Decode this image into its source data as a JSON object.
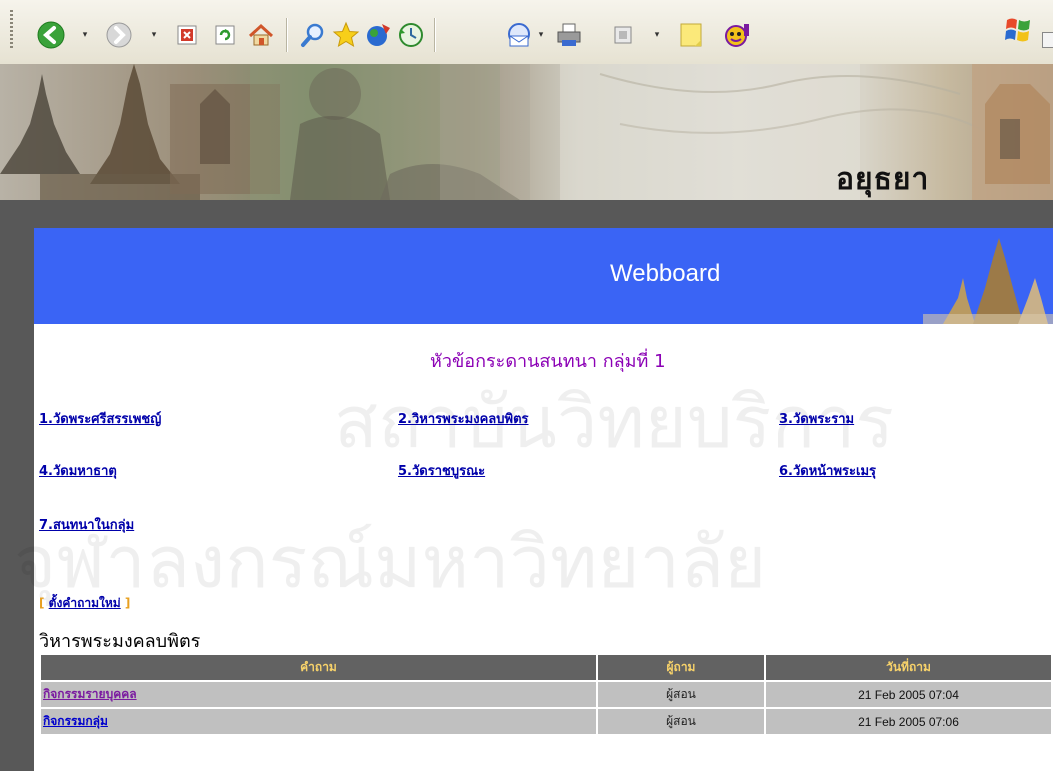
{
  "toolbar": {
    "buttons": [
      {
        "name": "back-button",
        "icon": "back-arrow-icon",
        "color": "#2e9a2e"
      },
      {
        "name": "forward-button",
        "icon": "forward-arrow-icon",
        "color": "#9a9a9a"
      },
      {
        "name": "stop-button",
        "icon": "stop-icon",
        "color": "#d23a2a"
      },
      {
        "name": "refresh-button",
        "icon": "refresh-icon",
        "color": "#2e9a2e"
      },
      {
        "name": "home-button",
        "icon": "home-icon",
        "color": "#e08a2a"
      },
      {
        "name": "search-button",
        "icon": "search-icon",
        "color": "#3a7ad0"
      },
      {
        "name": "favorites-button",
        "icon": "star-icon",
        "color": "#f2c21a"
      },
      {
        "name": "media-button",
        "icon": "media-icon",
        "color": "#2e7ad0"
      },
      {
        "name": "history-button",
        "icon": "history-icon",
        "color": "#2e9a2e"
      },
      {
        "name": "mail-button",
        "icon": "mail-icon",
        "color": "#3a6ad0"
      },
      {
        "name": "print-button",
        "icon": "printer-icon",
        "color": "#777777"
      },
      {
        "name": "edit-button",
        "icon": "edit-icon",
        "color": "#9a9a9a"
      },
      {
        "name": "discuss-button",
        "icon": "note-icon",
        "color": "#f6e06a"
      },
      {
        "name": "messenger-button",
        "icon": "messenger-icon",
        "color": "#9a2aa0"
      }
    ]
  },
  "banner": {
    "title": "อยุธยา"
  },
  "header": {
    "title": "Webboard",
    "background": "#3a64f5"
  },
  "main": {
    "heading": "หัวข้อกระดานสนทนา กลุ่มที่ 1",
    "topics": [
      {
        "label": "1.วัดพระศรีสรรเพชญ์"
      },
      {
        "label": "2.วิหารพระมงคลบพิตร"
      },
      {
        "label": "3.วัดพระราม"
      },
      {
        "label": "4.วัดมหาธาตุ"
      },
      {
        "label": "5.วัดราชบูรณะ"
      },
      {
        "label": "6.วัดหน้าพระเมรุ"
      },
      {
        "label": "7.สนทนาในกลุ่ม"
      }
    ],
    "new_question": {
      "open_bracket": "[",
      "label": "ตั้งคำถามใหม่",
      "close_bracket": "]"
    },
    "section_title": "วิหารพระมงคลบพิตร"
  },
  "table": {
    "headers": [
      "คำถาม",
      "ผู้ถาม",
      "วันที่ถาม"
    ],
    "rows": [
      {
        "question": "กิจกรรมรายบุคคล",
        "asker": "ผู้สอน",
        "date": "21 Feb 2005 07:04"
      },
      {
        "question": "กิจกรรมกลุ่ม",
        "asker": "ผู้สอน",
        "date": "21 Feb 2005 07:06"
      }
    ]
  },
  "watermark": {
    "line1": "สถาบันวิทยบริการ",
    "line2": "จุฬาลงกรณ์มหาวิทยาลัย"
  }
}
